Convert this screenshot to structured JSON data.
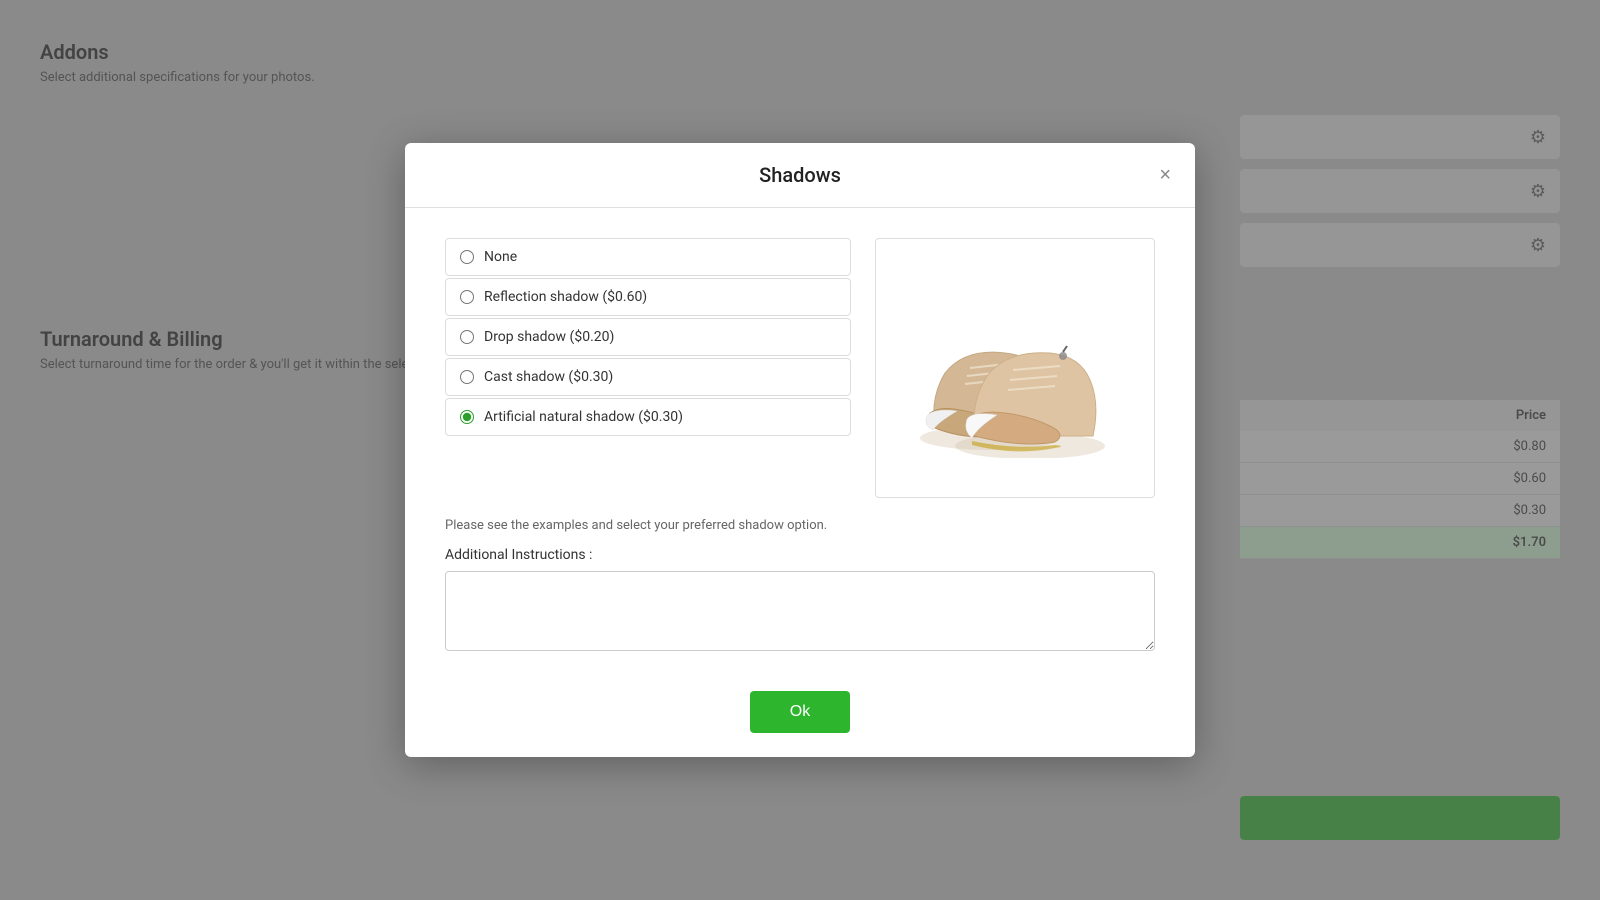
{
  "background": {
    "addons_title": "Addons",
    "addons_subtitle": "Select additional specifications for your photos.",
    "turnaround_title": "Turnaround & Billing",
    "turnaround_subtitle": "Select turnaround time for the order & you'll get it within the selecting longer turnaround time.",
    "table": {
      "price_header": "Price",
      "rows": [
        {
          "price": "$0.80"
        },
        {
          "price": "$0.60"
        },
        {
          "price": "$0.30"
        },
        {
          "price": "$1.70",
          "highlighted": true
        }
      ]
    }
  },
  "modal": {
    "title": "Shadows",
    "close_label": "×",
    "options": [
      {
        "id": "none",
        "label": "None",
        "checked": false
      },
      {
        "id": "reflection",
        "label": "Reflection shadow ($0.60)",
        "checked": false
      },
      {
        "id": "drop",
        "label": "Drop shadow ($0.20)",
        "checked": false
      },
      {
        "id": "cast",
        "label": "Cast shadow ($0.30)",
        "checked": false
      },
      {
        "id": "artificial",
        "label": "Artificial natural shadow ($0.30)",
        "checked": true
      }
    ],
    "hint": "Please see the examples and select your preferred shadow option.",
    "instructions_label": "Additional Instructions :",
    "instructions_placeholder": "",
    "ok_label": "Ok"
  }
}
